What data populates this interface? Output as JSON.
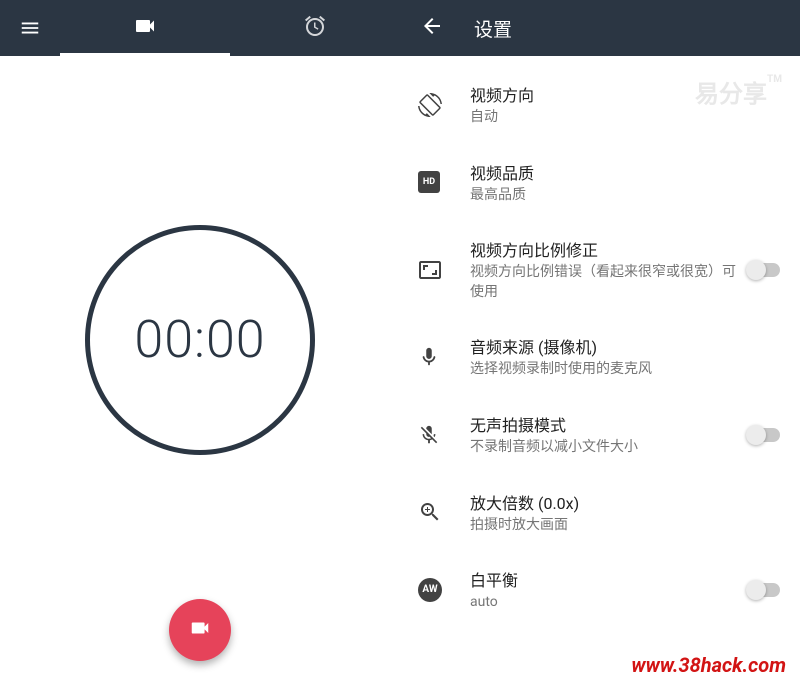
{
  "left": {
    "timer": "00:00"
  },
  "right": {
    "title": "设置",
    "items": [
      {
        "title": "视频方向",
        "subtitle": "自动"
      },
      {
        "title": "视频品质",
        "subtitle": "最高品质"
      },
      {
        "title": "视频方向比例修正",
        "subtitle": "视频方向比例错误（看起来很窄或很宽）可使用"
      },
      {
        "title": "音频来源 (摄像机)",
        "subtitle": "选择视频录制时使用的麦克风"
      },
      {
        "title": "无声拍摄模式",
        "subtitle": "不录制音频以减小文件大小"
      },
      {
        "title": "放大倍数 (0.0x)",
        "subtitle": "拍摄时放大画面"
      },
      {
        "title": "白平衡",
        "subtitle": "auto"
      }
    ]
  },
  "watermarks": {
    "top": "易分享",
    "url": "www.38hack.com"
  }
}
